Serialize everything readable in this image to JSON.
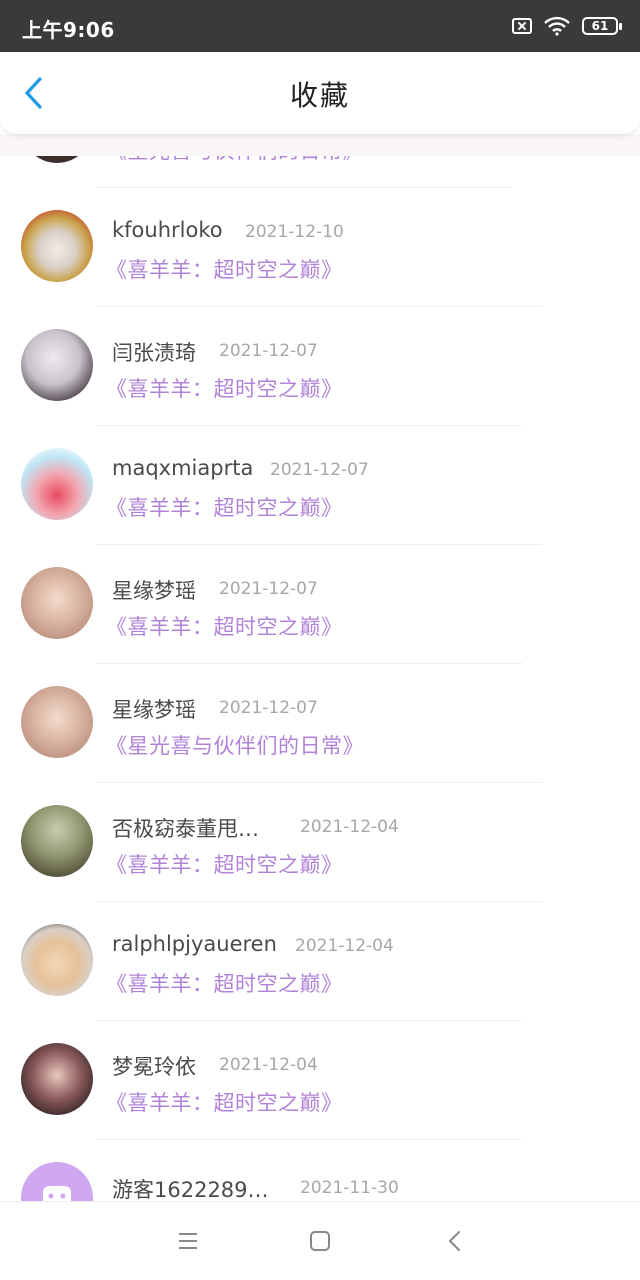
{
  "status_bar": {
    "time": "上午9:06",
    "battery": "61"
  },
  "header": {
    "title": "收藏"
  },
  "partial_top": {
    "work": "《星光喜与伙伴们的日常》"
  },
  "items": [
    {
      "user": "kfouhrloko",
      "date": "2021-12-10",
      "work": "《喜羊羊：超时空之巅》"
    },
    {
      "user": "闫张渍琦",
      "date": "2021-12-07",
      "work": "《喜羊羊：超时空之巅》"
    },
    {
      "user": "maqxmiaprta",
      "date": "2021-12-07",
      "work": "《喜羊羊：超时空之巅》"
    },
    {
      "user": "星缘梦瑶",
      "date": "2021-12-07",
      "work": "《喜羊羊：超时空之巅》"
    },
    {
      "user": "星缘梦瑶",
      "date": "2021-12-07",
      "work": "《星光喜与伙伴们的日常》"
    },
    {
      "user": "否极窈泰董甩…",
      "date": "2021-12-04",
      "work": "《喜羊羊：超时空之巅》"
    },
    {
      "user": "ralphlpjyaueren",
      "date": "2021-12-04",
      "work": "《喜羊羊：超时空之巅》"
    },
    {
      "user": "梦冕玲依",
      "date": "2021-12-04",
      "work": "《喜羊羊：超时空之巅》"
    },
    {
      "user": "游客1622289…",
      "date": "2021-11-30",
      "work": ""
    }
  ],
  "colors": {
    "accent": "#1e9be8",
    "work_title": "#b183d8",
    "status_bar": "#3a3a3a"
  },
  "icons": {
    "back": "chevron-left-icon",
    "nav": [
      "menu-icon",
      "home-square-icon",
      "back-triangle-icon"
    ]
  }
}
